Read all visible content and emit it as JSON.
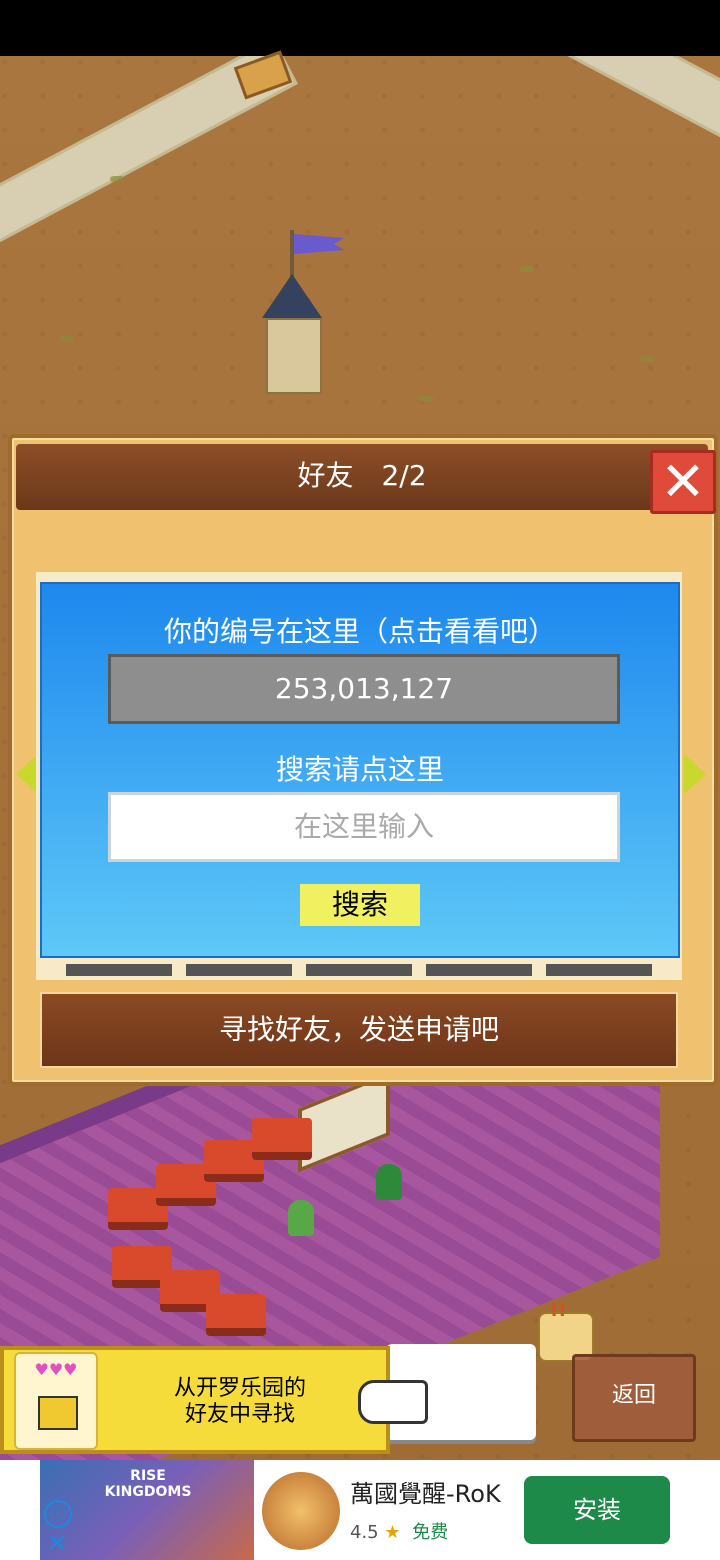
{
  "dialog": {
    "title": "好友　2/2",
    "close_label": "✕",
    "id_prompt": "你的编号在这里（点击看看吧）",
    "player_id": "253,013,127",
    "search_prompt": "搜索请点这里",
    "search_placeholder": "在这里输入",
    "search_button": "搜索",
    "find_friends_button": "寻找好友，发送申请吧"
  },
  "hint": {
    "text": "从开罗乐园的\n好友中寻找",
    "hearts": "♥♥♥",
    "badge": "!!"
  },
  "return_button": "返回",
  "ad": {
    "image_text": "RISE KINGDOMS",
    "info_icon": "ⓘ",
    "close_icon": "✕",
    "title": "萬國覺醒-RoK",
    "rating": "4.5",
    "star": "★",
    "price": "免费",
    "install_button": "安装"
  },
  "colors": {
    "header_brown": "#7a3f1e",
    "panel_blue": "#1e88ee",
    "search_button_yellow": "#f0f060",
    "close_red": "#e04a3a",
    "install_green": "#1e8a4a"
  }
}
